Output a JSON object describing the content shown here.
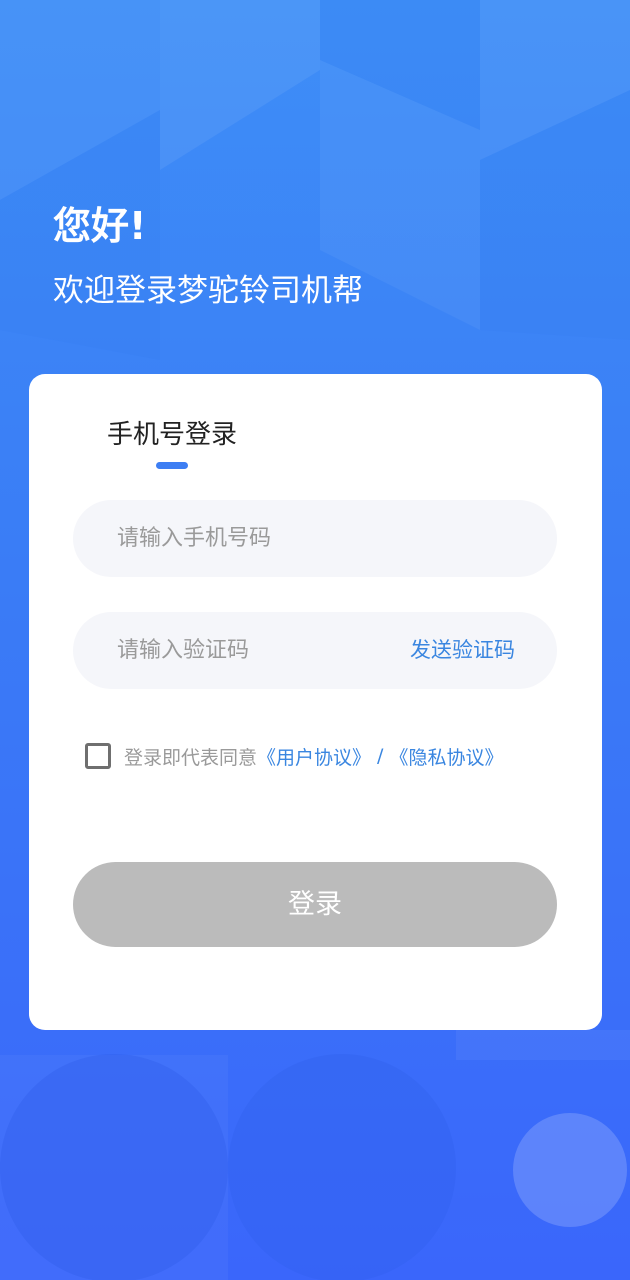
{
  "header": {
    "greeting": "您好!",
    "welcome": "欢迎登录梦驼铃司机帮"
  },
  "login_card": {
    "tab_label": "手机号登录",
    "phone_input": {
      "placeholder": "请输入手机号码",
      "value": ""
    },
    "code_input": {
      "placeholder": "请输入验证码",
      "value": ""
    },
    "send_code_label": "发送验证码",
    "agreement": {
      "checked": false,
      "prefix": "登录即代表同意",
      "user_agreement": "《用户协议》",
      "separator": "/",
      "privacy_agreement": "《隐私协议》"
    },
    "login_button_label": "登录"
  },
  "colors": {
    "background_top": "#3e8ef7",
    "background_bottom": "#3a66fb",
    "accent": "#3d7ef3",
    "link": "#3a86e0",
    "button_disabled": "#bbbbbb"
  }
}
